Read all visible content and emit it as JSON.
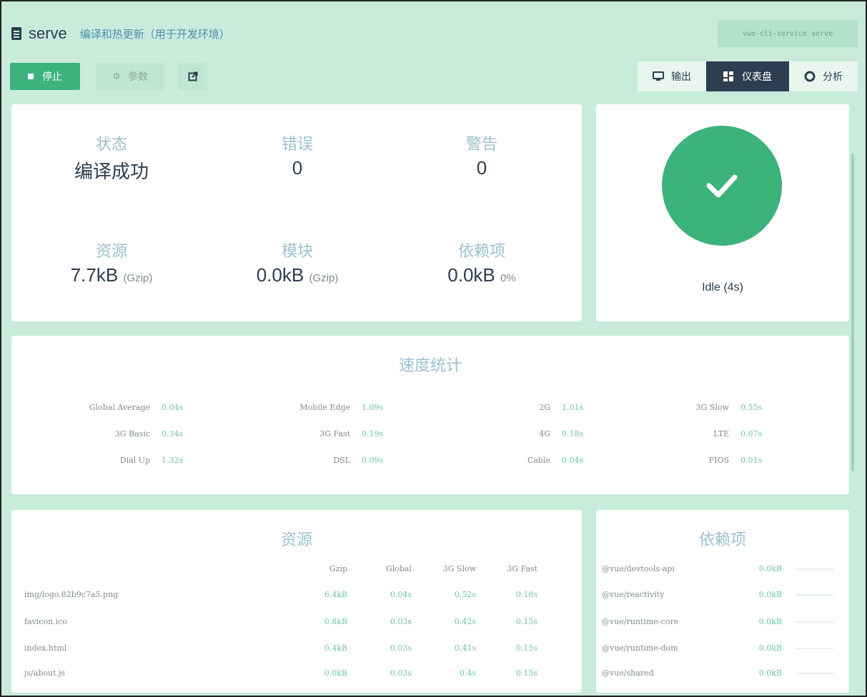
{
  "header": {
    "title": "serve",
    "description": "编译和热更新（用于开发环境）",
    "command": "vue-cli-service serve"
  },
  "toolbar": {
    "stop_label": "停止",
    "params_label": "参数"
  },
  "tabs": [
    {
      "label": "输出",
      "icon": "monitor-icon"
    },
    {
      "label": "仪表盘",
      "icon": "dashboard-icon",
      "active": true
    },
    {
      "label": "分析",
      "icon": "circle-icon"
    }
  ],
  "stats": {
    "status_label": "状态",
    "status_value": "编译成功",
    "errors_label": "错误",
    "errors_value": "0",
    "warnings_label": "警告",
    "warnings_value": "0",
    "assets_label": "资源",
    "assets_value": "7.7kB",
    "assets_unit": "(Gzip)",
    "modules_label": "模块",
    "modules_value": "0.0kB",
    "modules_unit": "(Gzip)",
    "deps_label": "依赖项",
    "deps_value": "0.0kB",
    "deps_pct": "0%"
  },
  "status_card": {
    "idle": "Idle (4s)"
  },
  "speed": {
    "title": "速度统计",
    "rows": [
      [
        {
          "name": "Global Average",
          "value": "0.04s"
        },
        {
          "name": "Mobile Edge",
          "value": "1.09s"
        },
        {
          "name": "2G",
          "value": "1.01s"
        },
        {
          "name": "3G Slow",
          "value": "0.55s"
        }
      ],
      [
        {
          "name": "3G Basic",
          "value": "0.34s"
        },
        {
          "name": "3G Fast",
          "value": "0.19s"
        },
        {
          "name": "4G",
          "value": "0.18s"
        },
        {
          "name": "LTE",
          "value": "0.07s"
        }
      ],
      [
        {
          "name": "Dial Up",
          "value": "1.32s"
        },
        {
          "name": "DSL",
          "value": "0.09s"
        },
        {
          "name": "Cable",
          "value": "0.04s"
        },
        {
          "name": "FIOS",
          "value": "0.01s"
        }
      ]
    ]
  },
  "assets": {
    "title": "资源",
    "columns": [
      "Gzip",
      "Global",
      "3G Slow",
      "3G Fast"
    ],
    "rows": [
      {
        "name": "img/logo.82b9c7a5.png",
        "gzip": "6.4kB",
        "global": "0.04s",
        "slow": "0.52s",
        "fast": "0.18s"
      },
      {
        "name": "favicon.ico",
        "gzip": "0.8kB",
        "global": "0.03s",
        "slow": "0.42s",
        "fast": "0.15s"
      },
      {
        "name": "index.html",
        "gzip": "0.4kB",
        "global": "0.03s",
        "slow": "0.41s",
        "fast": "0.15s"
      },
      {
        "name": "js/about.js",
        "gzip": "0.0kB",
        "global": "0.03s",
        "slow": "0.4s",
        "fast": "0.15s"
      }
    ]
  },
  "dependencies": {
    "title": "依赖项",
    "rows": [
      {
        "name": "@vue/devtools-api",
        "size": "0.0kB"
      },
      {
        "name": "@vue/reactivity",
        "size": "0.0kB"
      },
      {
        "name": "@vue/runtime-core",
        "size": "0.0kB"
      },
      {
        "name": "@vue/runtime-dom",
        "size": "0.0kB"
      },
      {
        "name": "@vue/shared",
        "size": "0.0kB"
      }
    ]
  }
}
